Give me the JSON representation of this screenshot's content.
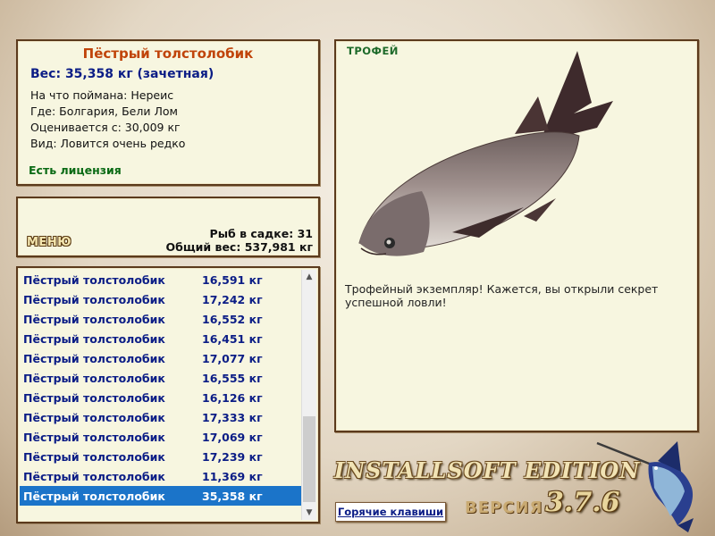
{
  "info": {
    "title": "Пёстрый толстолобик",
    "weight": "Вес: 35,358 кг (зачетная)",
    "caught_on": "На что поймана: Нереис",
    "where": "Где: Болгария, Бели Лом",
    "rated_from": "Оценивается с: 30,009 кг",
    "kind": "Вид: Ловится очень редко",
    "license": "Есть лицензия"
  },
  "menu": {
    "label": "МЕНЮ",
    "fish_in_keep": "Рыб в садке: 31",
    "total_weight": "Общий вес: 537,981 кг"
  },
  "fish_list": [
    {
      "name": "Пёстрый толстолобик",
      "weight": "16,591 кг"
    },
    {
      "name": "Пёстрый толстолобик",
      "weight": "17,242 кг"
    },
    {
      "name": "Пёстрый толстолобик",
      "weight": "16,552 кг"
    },
    {
      "name": "Пёстрый толстолобик",
      "weight": "16,451 кг"
    },
    {
      "name": "Пёстрый толстолобик",
      "weight": "17,077 кг"
    },
    {
      "name": "Пёстрый толстолобик",
      "weight": "16,555 кг"
    },
    {
      "name": "Пёстрый толстолобик",
      "weight": "16,126 кг"
    },
    {
      "name": "Пёстрый толстолобик",
      "weight": "17,333 кг"
    },
    {
      "name": "Пёстрый толстолобик",
      "weight": "17,069 кг"
    },
    {
      "name": "Пёстрый толстолобик",
      "weight": "17,239 кг"
    },
    {
      "name": "Пёстрый толстолобик",
      "weight": "11,369 кг"
    },
    {
      "name": "Пёстрый толстолобик",
      "weight": "35,358 кг",
      "selected": true
    }
  ],
  "trophy": {
    "label": "ТРОФЕЙ",
    "text": "Трофейный экземпляр! Кажется, вы открыли секрет успешной ловли!"
  },
  "footer": {
    "brand": "INSTALLSOFT EDITION",
    "version_label": "ВЕРСИЯ",
    "version_number": "3.7.6",
    "hotkeys": "Горячие клавиши"
  },
  "colors": {
    "title": "#c0440a",
    "weight": "#0b1d86",
    "license": "#0a6a14",
    "selection": "#1b74c9",
    "panel_bg": "#f7f6e0",
    "panel_border": "#5b3a1c"
  }
}
